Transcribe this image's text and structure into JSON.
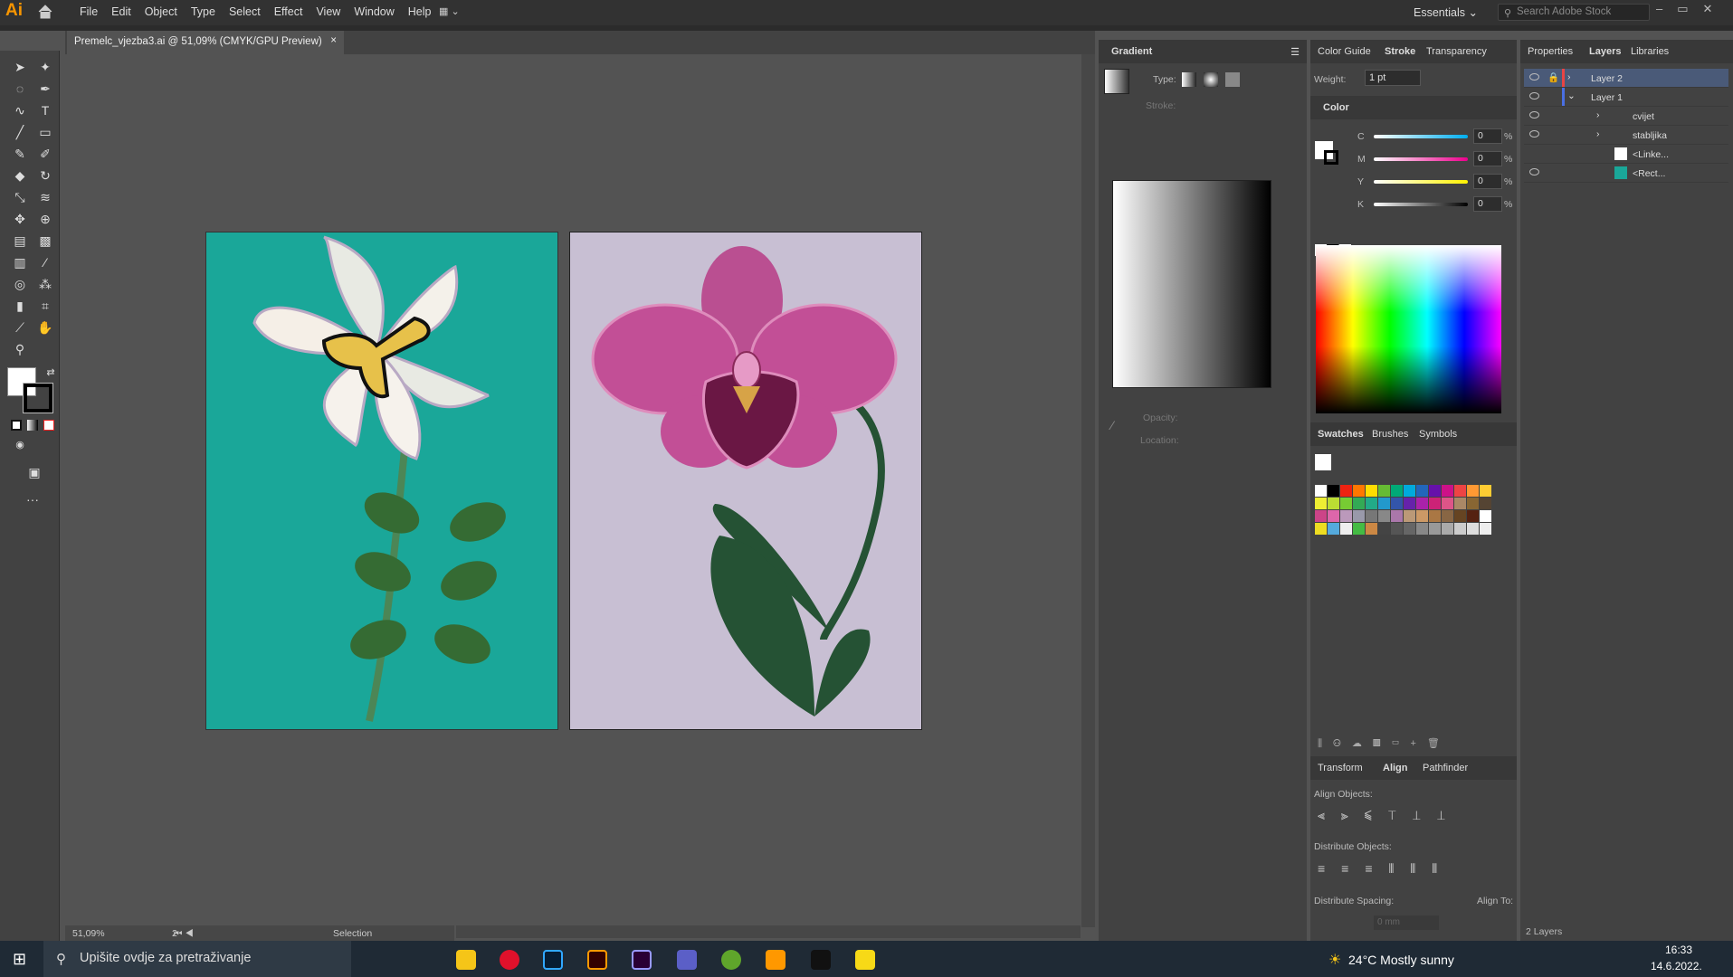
{
  "app": {
    "logo": "Ai",
    "menu": [
      "File",
      "Edit",
      "Object",
      "Type",
      "Select",
      "Effect",
      "View",
      "Window",
      "Help"
    ],
    "workspace": "Essentials",
    "search_placeholder": "Search Adobe Stock"
  },
  "document": {
    "tab_title": "Premelc_vjezba3.ai @ 51,09% (CMYK/GPU Preview)",
    "close": "×"
  },
  "status": {
    "zoom": "51,09%",
    "artboard": "2",
    "tool": "Selection"
  },
  "gradient_panel": {
    "title": "Gradient",
    "type_label": "Type:",
    "stroke_label": "Stroke:",
    "opacity_label": "Opacity:",
    "location_label": "Location:"
  },
  "stroke_panel": {
    "tabs": [
      "Color Guide",
      "Stroke",
      "Transparency"
    ],
    "weight_label": "Weight:",
    "weight_value": "1 pt"
  },
  "color_panel": {
    "title": "Color",
    "channels": [
      {
        "label": "C",
        "value": "0",
        "unit": "%"
      },
      {
        "label": "M",
        "value": "0",
        "unit": "%"
      },
      {
        "label": "Y",
        "value": "0",
        "unit": "%"
      },
      {
        "label": "K",
        "value": "0",
        "unit": "%"
      }
    ]
  },
  "swatches_panel": {
    "tabs": [
      "Swatches",
      "Brushes",
      "Symbols"
    ]
  },
  "align_panel": {
    "tabs": [
      "Transform",
      "Align",
      "Pathfinder"
    ],
    "align_objects": "Align Objects:",
    "distribute_objects": "Distribute Objects:",
    "distribute_spacing": "Distribute Spacing:",
    "align_to": "Align To:",
    "spacing_value": "0 mm"
  },
  "layers_panel": {
    "tabs": [
      "Properties",
      "Layers",
      "Libraries"
    ],
    "layers": [
      {
        "name": "Layer 2",
        "color": "#e94444"
      },
      {
        "name": "Layer 1",
        "color": "#4a6fe3"
      }
    ],
    "sublayers": [
      "cvijet",
      "stabljika",
      "<Linke...",
      "<Rect..."
    ],
    "footer": "2 Layers"
  },
  "taskbar": {
    "search": "Upišite ovdje za pretraživanje",
    "weather": "24°C  Mostly sunny",
    "time": "16:33",
    "date": "14.6.2022."
  }
}
